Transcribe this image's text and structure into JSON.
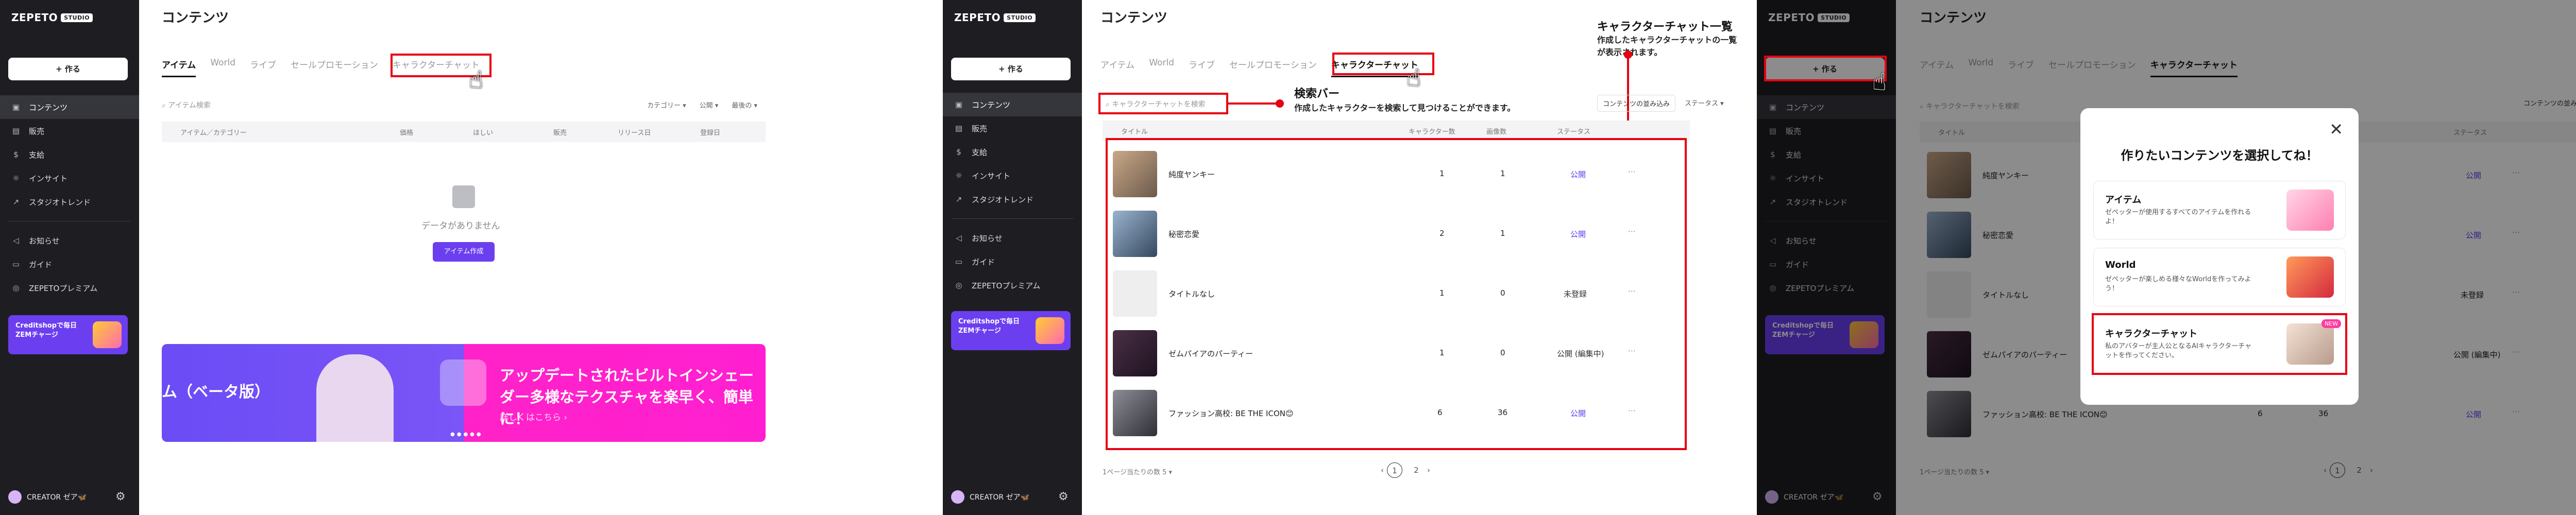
{
  "brand": {
    "logo": "ZEPETO",
    "studio_badge": "STUDIO"
  },
  "sidebar": {
    "create_label": "+ 作る",
    "items": [
      {
        "label": "コンテンツ",
        "icon": "content-icon"
      },
      {
        "label": "販売",
        "icon": "sales-icon"
      },
      {
        "label": "支給",
        "icon": "payout-icon"
      },
      {
        "label": "インサイト",
        "icon": "insight-icon"
      },
      {
        "label": "スタジオトレンド",
        "icon": "trend-icon"
      }
    ],
    "items2": [
      {
        "label": "お知らせ",
        "icon": "announcement-icon"
      },
      {
        "label": "ガイド",
        "icon": "guide-icon"
      },
      {
        "label": "ZEPETOプレミアム",
        "icon": "premium-icon"
      }
    ],
    "promo": "Creditshopで毎日ZEMチャージ",
    "creator": "CREATOR ゼア🦋"
  },
  "page_title": "コンテンツ",
  "tabs": [
    "アイテム",
    "World",
    "ライブ",
    "セールプロモーション",
    "キャラクターチャット"
  ],
  "screen1": {
    "search_placeholder": "アイテム検索",
    "filters": [
      "カテゴリー ▾",
      "公開 ▾",
      "最後の ▾"
    ],
    "headers": [
      "アイテム／カテゴリー",
      "価格",
      "ほしい",
      "販売",
      "リリース日",
      "登録日"
    ],
    "empty_text": "データがありません",
    "empty_button": "アイテム作成",
    "banner_left": "ム（ベータ版）",
    "banner_title": "アップデートされたビルトインシェーダー多様なテクスチャを楽早く、簡単に！",
    "banner_link": "詳しくはこちら ›"
  },
  "screen2": {
    "search_placeholder": "キャラクターチャットを検索",
    "sort_label": "コンテンツの並み込み",
    "status_label": "ステータス ▾",
    "headers": [
      "タイトル",
      "キャラクター数",
      "画像数",
      "ステータス"
    ],
    "rows": [
      {
        "title": "純度ヤンキー",
        "chars": "1",
        "images": "1",
        "status": "公開"
      },
      {
        "title": "秘密恋愛",
        "chars": "2",
        "images": "1",
        "status": "公開"
      },
      {
        "title": "タイトルなし",
        "chars": "1",
        "images": "0",
        "status": "未登録"
      },
      {
        "title": "ゼムパイアのパーティー",
        "chars": "1",
        "images": "0",
        "status": "公開 (編集中)"
      },
      {
        "title": "ファッション高校: BE THE ICON😊",
        "chars": "6",
        "images": "36",
        "status": "公開"
      }
    ],
    "per_page": "1ページ当たりの数",
    "per_page_value": "5 ▾",
    "pages": [
      "1",
      "2"
    ],
    "annot_list_title": "キャラクターチャット一覧",
    "annot_list_desc": "作成したキャラクターチャットの一覧が表示されます。",
    "annot_search_title": "検索バー",
    "annot_search_desc": "作成したキャラクターを検索して見つけることができます。"
  },
  "screen3": {
    "modal_title": "作りたいコンテンツを選択してね！",
    "cards": [
      {
        "title": "アイテム",
        "desc": "ゼペッターが使用するすべてのアイテムを作れるよ！"
      },
      {
        "title": "World",
        "desc": "ゼペッターが楽しめる様々なWorldを作ってみよう！"
      },
      {
        "title": "キャラクターチャット",
        "desc": "私のアバターが主人公となるAIキャラクターチャットを作ってください。",
        "badge": "NEW"
      }
    ]
  },
  "colors": {
    "accent": "#6b3ff0",
    "highlight": "#e60012",
    "sidebar": "#1e1e22",
    "banner_pink": "#ff1fd1"
  },
  "icons": [
    "close-icon",
    "search-icon",
    "gear-icon",
    "more-icon",
    "pointer-hand-icon"
  ]
}
